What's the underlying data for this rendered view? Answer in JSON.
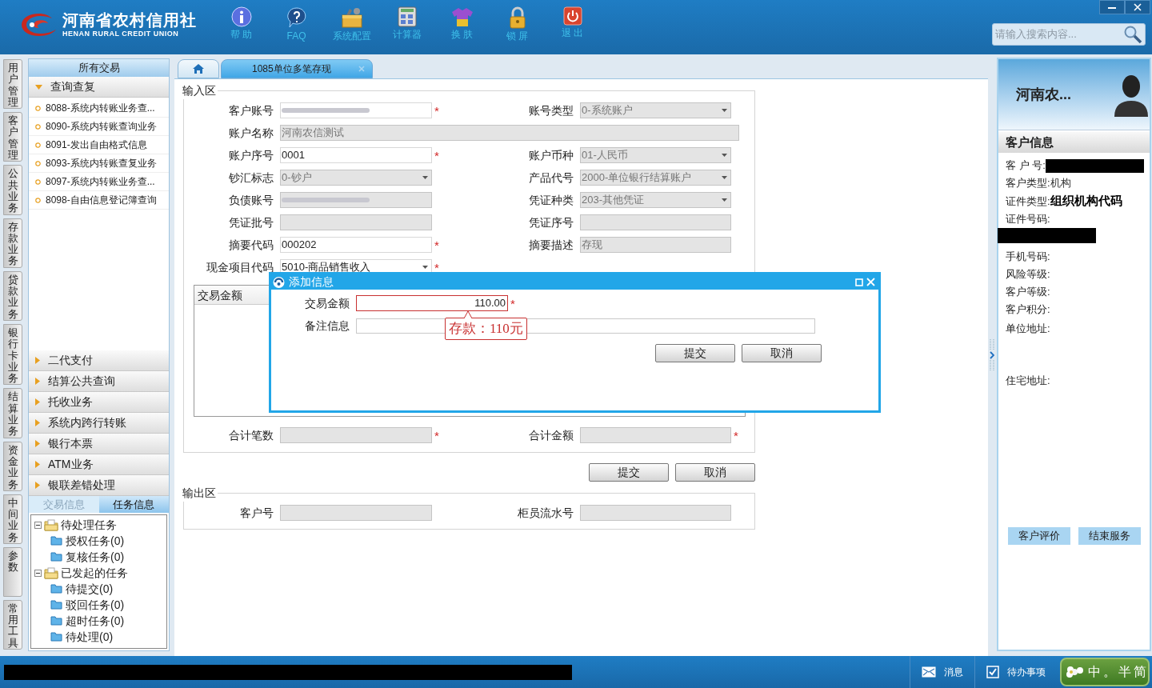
{
  "header": {
    "logo_title": "河南省农村信用社",
    "logo_subtitle": "HENAN RURAL CREDIT UNION",
    "toolbar": [
      {
        "label": "帮 助"
      },
      {
        "label": "FAQ"
      },
      {
        "label": "系统配置"
      },
      {
        "label": "计算器"
      },
      {
        "label": "换 肤"
      },
      {
        "label": "锁 屏"
      },
      {
        "label": "退 出"
      }
    ],
    "search": {
      "placeholder": "请输入搜索内容..."
    }
  },
  "side_tabs": [
    "用户管理",
    "客户管理",
    "公共业务",
    "存款业务",
    "贷款业务",
    "银行卡业务",
    "结算业务",
    "资金业务",
    "中间业务",
    "参数",
    "常用工具"
  ],
  "nav": {
    "title": "所有交易",
    "groups": [
      {
        "label": "查询查复",
        "expanded": true,
        "items": [
          "8088-系统内转账业务查...",
          "8090-系统内转账查询业务",
          "8091-发出自由格式信息",
          "8093-系统内转账查复业务",
          "8097-系统内转账业务查...",
          "8098-自由信息登记簿查询"
        ]
      },
      {
        "label": "二代支付",
        "expanded": false
      },
      {
        "label": "结算公共查询",
        "expanded": false
      },
      {
        "label": "托收业务",
        "expanded": false
      },
      {
        "label": "系统内跨行转账",
        "expanded": false
      },
      {
        "label": "银行本票",
        "expanded": false
      },
      {
        "label": "ATM业务",
        "expanded": false
      },
      {
        "label": "银联差错处理",
        "expanded": false
      }
    ],
    "info_tabs": [
      {
        "label": "交易信息",
        "selected": false
      },
      {
        "label": "任务信息",
        "selected": true
      }
    ],
    "tree": [
      {
        "label": "待处理任务",
        "expanded": true,
        "children": [
          {
            "label": "授权任务(0)"
          },
          {
            "label": "复核任务(0)"
          }
        ]
      },
      {
        "label": "已发起的任务",
        "expanded": true,
        "children": [
          {
            "label": "待提交(0)"
          },
          {
            "label": "驳回任务(0)"
          },
          {
            "label": "超时任务(0)"
          },
          {
            "label": "待处理(0)"
          }
        ]
      }
    ]
  },
  "tabs": [
    {
      "kind": "home",
      "selected": false
    },
    {
      "kind": "page",
      "label": "1085单位多笔存现",
      "selected": true
    }
  ],
  "input_section": {
    "title": "输入区",
    "rows": [
      {
        "left": {
          "label": "客户账号",
          "kind": "redacted",
          "readonly": false,
          "required_mark": "*"
        },
        "right": {
          "label": "账号类型",
          "kind": "select",
          "value": "0-系统账户",
          "readonly": true
        }
      },
      {
        "wide": {
          "label": "账户名称",
          "kind": "text",
          "value": "河南农信测试",
          "readonly": true
        }
      },
      {
        "left": {
          "label": "账户序号",
          "kind": "text",
          "value": "0001",
          "readonly": false,
          "required_mark": "*"
        },
        "right": {
          "label": "账户币种",
          "kind": "select",
          "value": "01-人民币",
          "readonly": true
        }
      },
      {
        "left": {
          "label": "钞汇标志",
          "kind": "select",
          "value": "0-钞户",
          "readonly": true
        },
        "right": {
          "label": "产品代号",
          "kind": "select",
          "value": "2000-单位银行结算账户",
          "readonly": true
        }
      },
      {
        "left": {
          "label": "负债账号",
          "kind": "redacted",
          "readonly": true
        },
        "right": {
          "label": "凭证种类",
          "kind": "select",
          "value": "203-其他凭证",
          "readonly": true
        }
      },
      {
        "left": {
          "label": "凭证批号",
          "kind": "text",
          "readonly": true
        },
        "right": {
          "label": "凭证序号",
          "kind": "text",
          "readonly": true
        }
      },
      {
        "left": {
          "label": "摘要代码",
          "kind": "text",
          "value": "000202",
          "readonly": false,
          "required_mark": "*"
        },
        "right": {
          "label": "摘要描述",
          "kind": "text",
          "value": "存现",
          "readonly": true
        }
      },
      {
        "left": {
          "label": "现金项目代码",
          "kind": "select",
          "value": "5010-商品销售收入",
          "readonly": false,
          "required_mark": "*"
        }
      }
    ],
    "table": {
      "columns": [
        "交易金额"
      ]
    },
    "totals": [
      {
        "label": "合计笔数",
        "required_mark": "*"
      },
      {
        "label": "合计金额",
        "required_mark": "*"
      }
    ],
    "buttons": [
      "提交",
      "取消"
    ]
  },
  "output_section": {
    "title": "输出区",
    "fields": [
      {
        "label": "客户号"
      },
      {
        "label": "柜员流水号"
      }
    ]
  },
  "dialog": {
    "title": "添加信息",
    "amount": {
      "label": "交易金额",
      "value": "110.00",
      "required_mark": "*",
      "error": true
    },
    "tooltip": "存款：110元",
    "remark": {
      "label": "备注信息"
    },
    "buttons": [
      "提交",
      "取消"
    ]
  },
  "customer": {
    "name": "河南农...",
    "section": "客户信息",
    "info": [
      {
        "label": "客 户 号:",
        "kind": "redacted_inline"
      },
      {
        "label": "客户类型:",
        "value": "机构",
        "kind": "text"
      },
      {
        "label": "证件类型:",
        "value": "组织机构代码",
        "kind": "emphasis"
      },
      {
        "label": "证件号码:",
        "kind": "redacted_below"
      },
      {
        "label": "手机号码:",
        "kind": "text"
      },
      {
        "label": "风险等级:",
        "kind": "text"
      },
      {
        "label": "客户等级:",
        "kind": "text"
      },
      {
        "label": "客户积分:",
        "kind": "text"
      },
      {
        "label": "单位地址:",
        "kind": "address"
      },
      {
        "label": "住宅地址:",
        "kind": "address"
      }
    ],
    "buttons": [
      "客户评价",
      "结束服务"
    ]
  },
  "status_bar": {
    "items": [
      {
        "kind": "message",
        "label": "消息"
      },
      {
        "kind": "todo",
        "label": "待办事项"
      }
    ],
    "ime": [
      "中",
      "。",
      "半",
      "简"
    ]
  }
}
